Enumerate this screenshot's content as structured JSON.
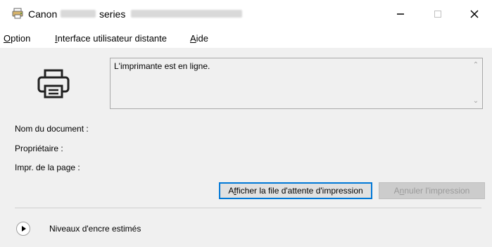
{
  "window": {
    "title_brand": "Canon",
    "title_series": "series",
    "controls": {
      "minimize": "–",
      "maximize": "☐",
      "close": "✕"
    }
  },
  "menu": [
    {
      "mnemonic": "O",
      "rest": "ption"
    },
    {
      "mnemonic": "I",
      "rest": "nterface utilisateur distante"
    },
    {
      "mnemonic": "A",
      "rest": "ide"
    }
  ],
  "status": {
    "message": "L'imprimante est en ligne."
  },
  "info": {
    "document_label": "Nom du document :",
    "owner_label": "Propriétaire :",
    "page_label": "Impr. de la page :"
  },
  "buttons": {
    "queue_pre": "A",
    "queue_mnemonic": "f",
    "queue_post": "ficher la file d'attente d'impression",
    "cancel_pre": "A",
    "cancel_mnemonic": "n",
    "cancel_post": "nuler l'impression"
  },
  "ink": {
    "label": "Niveaux d'encre estimés"
  }
}
